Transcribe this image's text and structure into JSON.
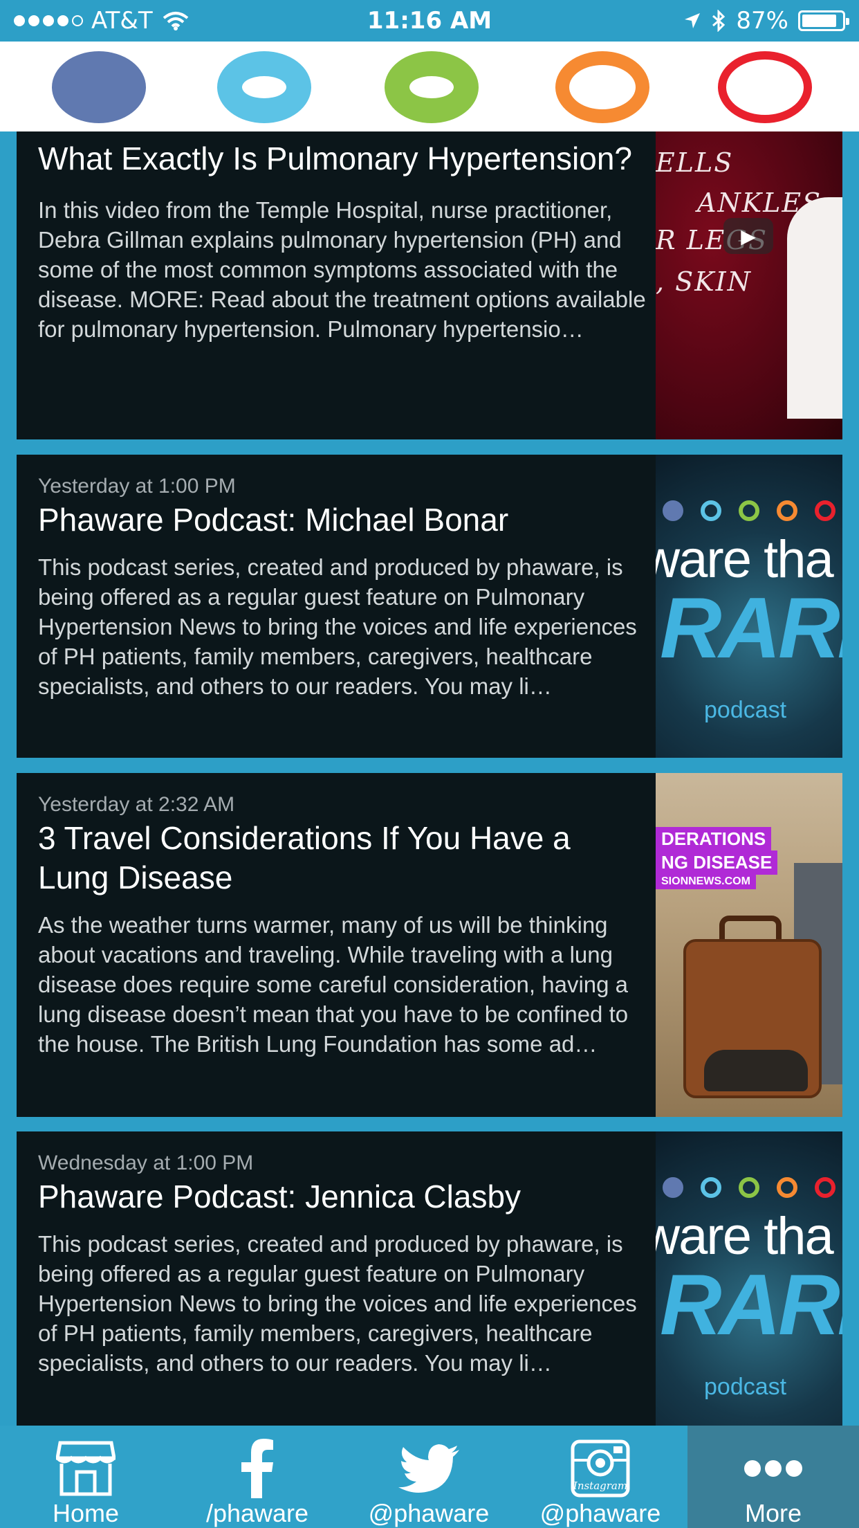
{
  "status_bar": {
    "carrier": "AT&T",
    "time": "11:16 AM",
    "battery_percent": "87%",
    "battery_level": 0.87
  },
  "logo_rings": [
    {
      "color": "#6079b0",
      "style": "filled"
    },
    {
      "color": "#5cc3e6",
      "style": "thick"
    },
    {
      "color": "#8cc546",
      "style": "thick"
    },
    {
      "color": "#f68a32",
      "style": "medium"
    },
    {
      "color": "#e9212d",
      "style": "thin"
    }
  ],
  "feed": {
    "items": [
      {
        "date": "",
        "title": "What Exactly Is Pulmonary Hypertension?",
        "excerpt": "In this video from the Temple Hospital, nurse practitioner, Debra Gillman explains pulmonary hypertension (PH) and some of the most common symptoms associated with the disease. MORE: Read about the treatment options available for pulmonary hypertension. Pulmonary hypertensio…",
        "thumbnail": "video",
        "thumb_text": [
          "ELLS",
          "ANKLES,",
          "R LEGS",
          ", SKIN"
        ]
      },
      {
        "date": "Yesterday at 1:00 PM",
        "title": "Phaware Podcast: Michael Bonar",
        "excerpt": "This podcast series, created and produced by phaware, is being offered as a regular guest feature on Pulmonary Hypertension News to bring the voices and life experiences of PH patients, family members, caregivers, healthcare specialists, and others to our readers. You may li…",
        "thumbnail": "podcast",
        "thumb_text": [
          "aware tha",
          "RARE",
          "podcast"
        ]
      },
      {
        "date": "Yesterday at 2:32 AM",
        "title": "3 Travel Considerations If You Have a Lung Disease",
        "excerpt": "As the weather turns warmer, many of us will be thinking about vacations and traveling. While traveling with a lung disease does require some careful consideration, having a lung disease doesn’t mean that you have to be confined to the house. The British Lung Foundation has some ad…",
        "thumbnail": "travel",
        "thumb_text": [
          "DERATIONS",
          "NG DISEASE",
          "SIONNEWS.COM"
        ]
      },
      {
        "date": "Wednesday at 1:00 PM",
        "title": "Phaware Podcast: Jennica Clasby",
        "excerpt": "This podcast series, created and produced by phaware, is being offered as a regular guest feature on Pulmonary Hypertension News to bring the voices and life experiences of PH patients, family members, caregivers, healthcare specialists, and others to our readers. You may li…",
        "thumbnail": "podcast",
        "thumb_text": [
          "aware tha",
          "RARE",
          "podcast"
        ]
      }
    ]
  },
  "tab_bar": {
    "tabs": [
      {
        "label": "Home",
        "icon": "store-icon"
      },
      {
        "label": "/phaware",
        "icon": "facebook-icon"
      },
      {
        "label": "@phaware",
        "icon": "twitter-bird-icon"
      },
      {
        "label": "@phaware",
        "icon": "instagram-icon",
        "icon_text": "Instagram"
      },
      {
        "label": "More",
        "icon": "more-dots-icon",
        "active": true
      }
    ]
  }
}
